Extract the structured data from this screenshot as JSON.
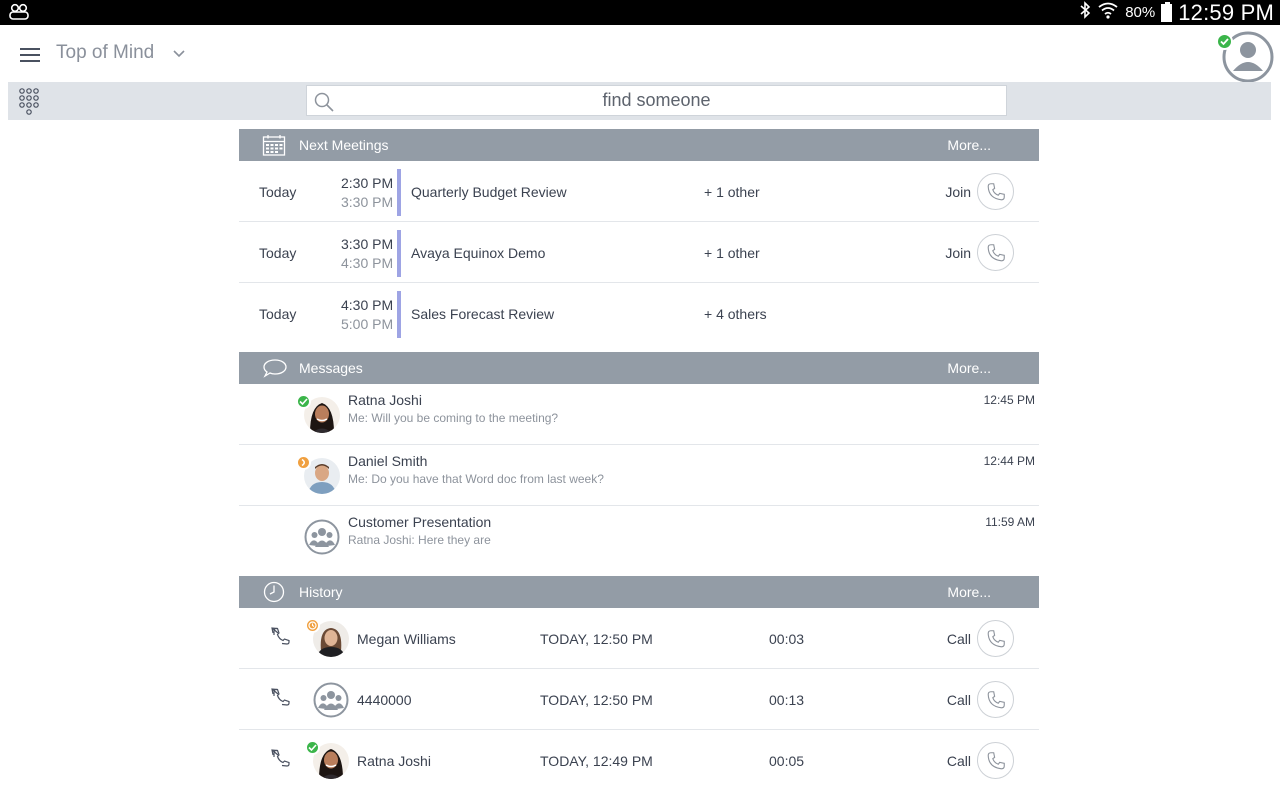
{
  "status_bar": {
    "battery": "80%",
    "time": "12:59 PM"
  },
  "header": {
    "title": "Top of Mind"
  },
  "search": {
    "placeholder": "find someone"
  },
  "meetings": {
    "title": "Next Meetings",
    "more": "More...",
    "items": [
      {
        "day": "Today",
        "start": "2:30 PM",
        "end": "3:30 PM",
        "subject": "Quarterly Budget Review",
        "participants": "+ 1 other",
        "join": "Join"
      },
      {
        "day": "Today",
        "start": "3:30 PM",
        "end": "4:30 PM",
        "subject": "Avaya Equinox Demo",
        "participants": "+ 1 other",
        "join": "Join"
      },
      {
        "day": "Today",
        "start": "4:30 PM",
        "end": "5:00 PM",
        "subject": "Sales Forecast Review",
        "participants": "+ 4 others",
        "join": ""
      }
    ]
  },
  "messages": {
    "title": "Messages",
    "more": "More...",
    "items": [
      {
        "name": "Ratna Joshi",
        "preview": "Me: Will you be coming to the meeting?",
        "time": "12:45 PM",
        "presence": "available"
      },
      {
        "name": "Daniel Smith",
        "preview": "Me: Do you have that Word doc from last week?",
        "time": "12:44 PM",
        "presence": "away"
      },
      {
        "name": "Customer Presentation",
        "preview": "Ratna Joshi: Here they are",
        "time": "11:59 AM",
        "presence": ""
      }
    ]
  },
  "history": {
    "title": "History",
    "more": "More...",
    "items": [
      {
        "name": "Megan Williams",
        "when": "TODAY, 12:50 PM",
        "duration": "00:03",
        "action": "Call",
        "presence": "away"
      },
      {
        "name": "4440000",
        "when": "TODAY, 12:50 PM",
        "duration": "00:13",
        "action": "Call",
        "presence": ""
      },
      {
        "name": "Ratna Joshi",
        "when": "TODAY, 12:49 PM",
        "duration": "00:05",
        "action": "Call",
        "presence": "available"
      }
    ]
  },
  "colors": {
    "section_header": "#939ca6",
    "meeting_bar": "#9ea4e4",
    "available": "#3bb54a",
    "away": "#f0a040"
  }
}
